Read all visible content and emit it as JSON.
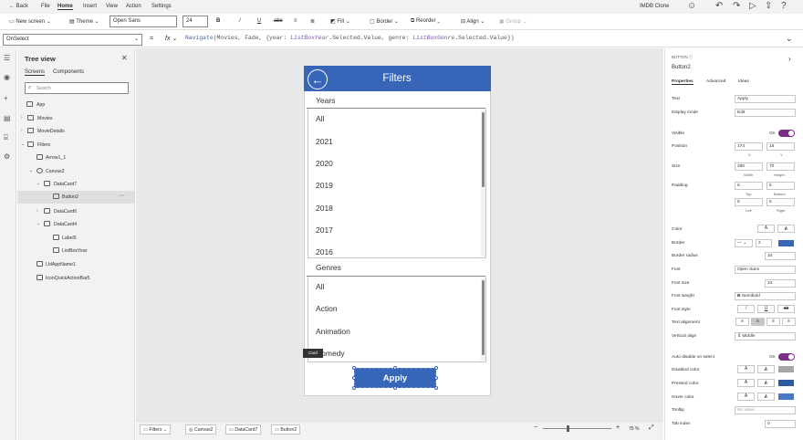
{
  "menu": {
    "back": "Back",
    "file": "File",
    "home": "Home",
    "insert": "Insert",
    "view": "View",
    "action": "Action",
    "settings": "Settings",
    "app_title": "IMDB Clone"
  },
  "toolbar": {
    "new_screen": "New screen",
    "theme": "Theme",
    "font": "Open Sans",
    "font_size": "24",
    "bold": "B",
    "italic": "/",
    "underline": "U",
    "strike": "abc",
    "align": "≡",
    "fill": "Fill",
    "border": "Border",
    "reorder": "Reorder",
    "align_menu": "Align",
    "group": "Group"
  },
  "formula_bar": {
    "property": "OnSelect",
    "eq": "=",
    "fx": "fx",
    "formula_parts": {
      "p1": "Navigate",
      "p2": "(Movies, Fade, {year: ",
      "p3": "ListBoxYear",
      "p4": ".Selected.Value, genre: ",
      "p5": "ListBoxGenre",
      "p6": ".Selected.Value})"
    }
  },
  "tree": {
    "title": "Tree view",
    "tab_screens": "Screens",
    "tab_components": "Components",
    "search_placeholder": "Search",
    "nodes": [
      "App",
      "Movies",
      "MovieDetails",
      "Filters",
      "Arrow1_1",
      "Canvas2",
      "DataCard7",
      "Button2",
      "DataCard6",
      "DataCard4",
      "Label5",
      "ListBoxYear",
      "LblAppName1",
      "IconQuickActionBar5"
    ],
    "more": "···"
  },
  "screen": {
    "title": "Filters",
    "years_label": "Years",
    "years": [
      "All",
      "2021",
      "2020",
      "2019",
      "2018",
      "2017",
      "2016"
    ],
    "genres_label": "Genres",
    "genres": [
      "All",
      "Action",
      "Animation",
      "Comedy"
    ],
    "card_tip": "Card",
    "apply": "Apply"
  },
  "statusbar": {
    "crumbs": [
      "Filters",
      "Canvas2",
      "DataCard7",
      "Button2"
    ],
    "minus": "−",
    "plus": "+",
    "zoom": "75 %"
  },
  "props": {
    "type": "BUTTON",
    "name": "Button2",
    "tabs": [
      "Properties",
      "Advanced",
      "Ideas"
    ],
    "text_label": "Text",
    "text_value": "Apply",
    "display_mode_label": "Display mode",
    "display_mode_value": "Edit",
    "visible_label": "Visible",
    "visible_value": "On",
    "position_label": "Position",
    "pos_x": "174",
    "pos_y": "15",
    "x_label": "X",
    "y_label": "Y",
    "size_label": "Size",
    "width": "280",
    "height": "70",
    "width_label": "Width",
    "height_label": "Height",
    "padding_label": "Padding",
    "pad_top": "5",
    "pad_bottom": "5",
    "pad_left": "5",
    "pad_right": "5",
    "top_label": "Top",
    "bottom_label": "Bottom",
    "left_label": "Left",
    "right_label": "Right",
    "color_label": "Color",
    "border_label": "Border",
    "border_width": "2",
    "border_radius_label": "Border radius",
    "border_radius": "10",
    "font_label": "Font",
    "font_value": "Open Sans",
    "font_size_label": "Font size",
    "font_size_value": "24",
    "font_weight_label": "Font weight",
    "font_weight_value": "Semibold",
    "font_style_label": "Font style",
    "text_align_label": "Text alignment",
    "vertical_align_label": "Vertical align",
    "vertical_align_value": "Middle",
    "auto_disable_label": "Auto disable on select",
    "auto_disable_value": "On",
    "disabled_color_label": "Disabled color",
    "pressed_color_label": "Pressed color",
    "hover_color_label": "Hover color",
    "tooltip_label": "Tooltip",
    "tooltip_placeholder": "No value",
    "tab_index_label": "Tab index",
    "tab_index": "0"
  },
  "colors": {
    "accent": "#3765b8",
    "toggle": "#7a2e86",
    "panel": "#f3f2f1"
  }
}
